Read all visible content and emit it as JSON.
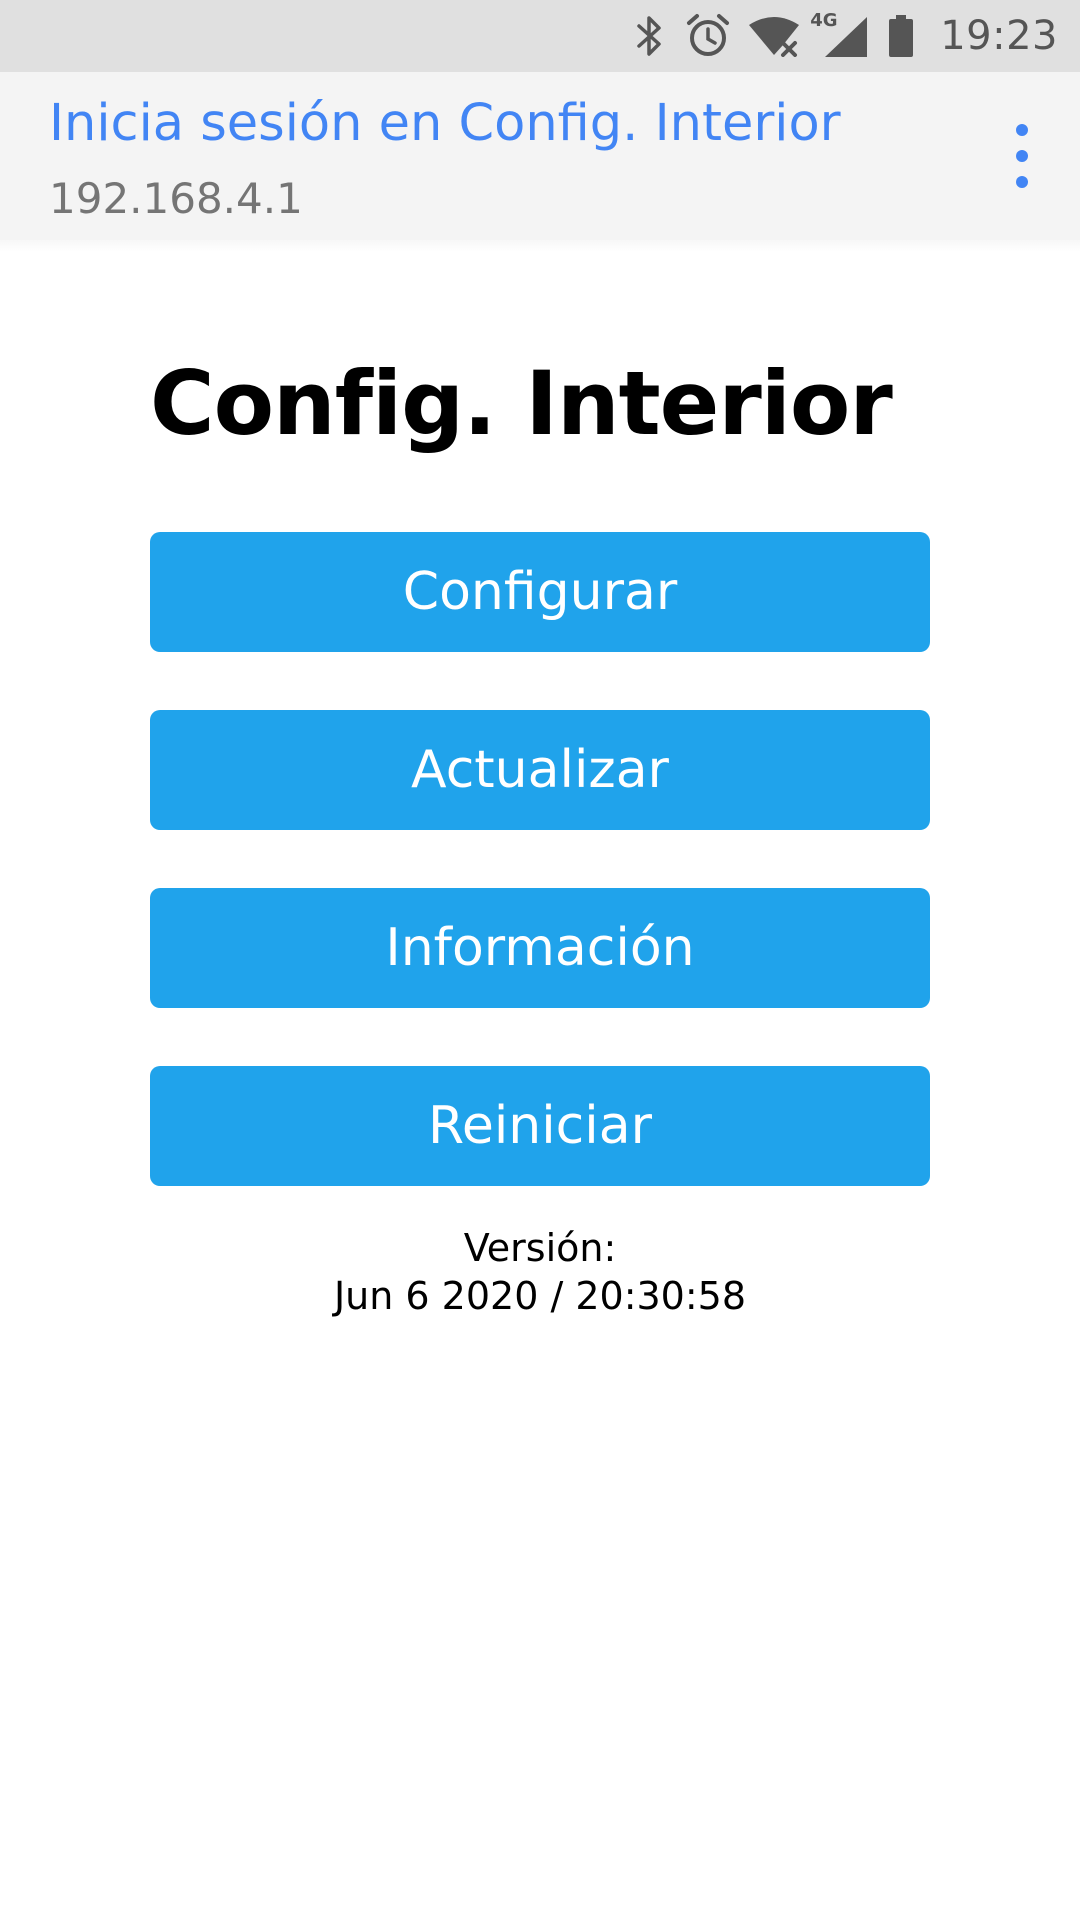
{
  "status_bar": {
    "time": "19:23",
    "network_label": "4G",
    "icons": [
      "bluetooth-icon",
      "alarm-icon",
      "wifi-no-internet-icon",
      "signal-4g-icon",
      "battery-icon"
    ]
  },
  "header": {
    "title": "Inicia sesión en Config. Interior",
    "subtitle": "192.168.4.1",
    "menu_icon": "more-vert-icon",
    "accent_color": "#4285f4"
  },
  "main": {
    "title": "Config. Interior",
    "button_color": "#20a3eb",
    "buttons": [
      {
        "label": "Configurar"
      },
      {
        "label": "Actualizar"
      },
      {
        "label": "Información"
      },
      {
        "label": "Reiniciar"
      }
    ],
    "version_label": "Versión:",
    "version_value": "Jun 6 2020 / 20:30:58"
  }
}
